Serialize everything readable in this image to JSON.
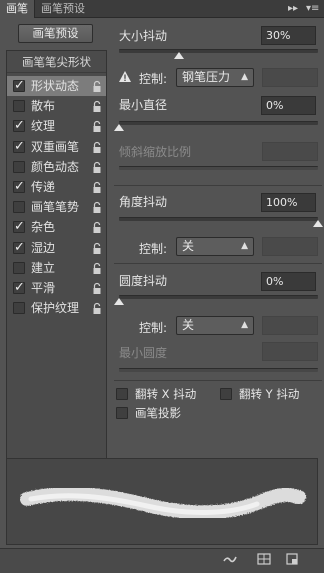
{
  "tabs": [
    {
      "label": "画笔"
    },
    {
      "label": "画笔预设"
    }
  ],
  "tab_controls": {
    "collapse": "▸▸",
    "menu": "▾≡"
  },
  "left": {
    "preset_button": "画笔预设",
    "tip_header": "画笔笔尖形状",
    "items": [
      {
        "label": "形状动态",
        "checked": true,
        "selected": true
      },
      {
        "label": "散布",
        "checked": false
      },
      {
        "label": "纹理",
        "checked": true
      },
      {
        "label": "双重画笔",
        "checked": true
      },
      {
        "label": "颜色动态",
        "checked": false
      },
      {
        "label": "传递",
        "checked": true
      },
      {
        "label": "画笔笔势",
        "checked": false
      },
      {
        "label": "杂色",
        "checked": true
      },
      {
        "label": "湿边",
        "checked": true
      },
      {
        "label": "建立",
        "checked": false
      },
      {
        "label": "平滑",
        "checked": true
      },
      {
        "label": "保护纹理",
        "checked": false
      }
    ]
  },
  "size_jitter": {
    "label": "大小抖动",
    "value": "30%",
    "level": 0.3
  },
  "control1": {
    "label": "控制:",
    "value": "钢笔压力"
  },
  "min_diameter": {
    "label": "最小直径",
    "value": "0%",
    "level": 0
  },
  "tilt_scale": {
    "label": "倾斜缩放比例",
    "value": ""
  },
  "angle_jitter": {
    "label": "角度抖动",
    "value": "100%",
    "level": 1.0
  },
  "control2": {
    "label": "控制:",
    "value": "关"
  },
  "roundness_jitter": {
    "label": "圆度抖动",
    "value": "0%",
    "level": 0
  },
  "control3": {
    "label": "控制:",
    "value": "关"
  },
  "min_roundness": {
    "label": "最小圆度",
    "value": ""
  },
  "flip": {
    "flip_x": "翻转 X 抖动",
    "flip_y": "翻转 Y 抖动",
    "brush_projection": "画笔投影"
  },
  "colors": {
    "panel": "#535353",
    "dark": "#3a3a3a",
    "text": "#e6e6e6"
  }
}
